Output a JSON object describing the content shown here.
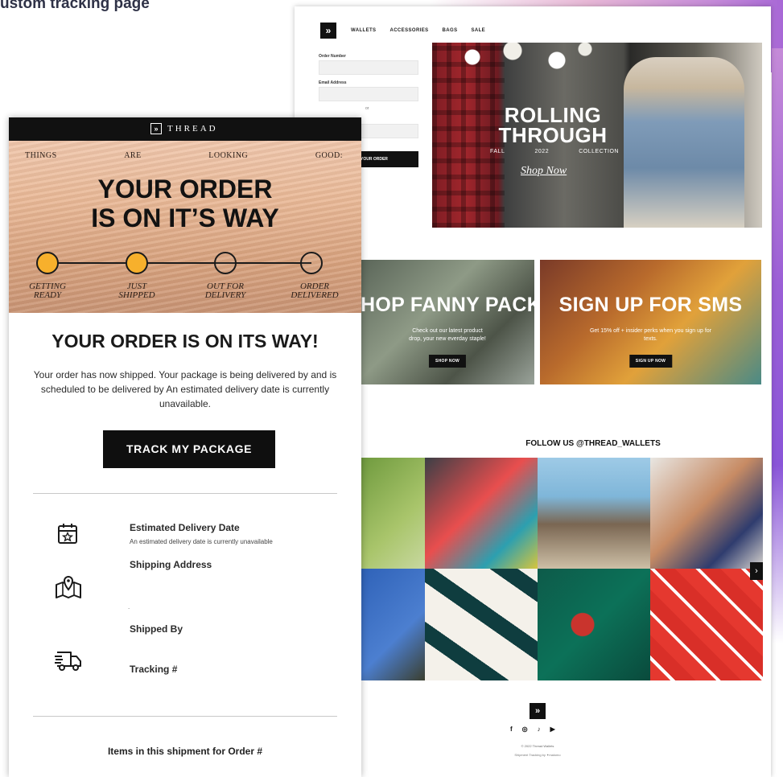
{
  "caption": "ustom tracking page",
  "store": {
    "logo": "»",
    "nav": [
      "WALLETS",
      "ACCESSORIES",
      "BAGS",
      "SALE"
    ],
    "form": {
      "order_label": "Order Number",
      "email_label": "Email Address",
      "or": "or",
      "button": "YOUR ORDER"
    },
    "hero": {
      "title_line1": "ROLLING",
      "title_line2": "THROUGH",
      "sub": [
        "FALL",
        "2022",
        "COLLECTION"
      ],
      "link": "Shop Now"
    },
    "promo_left": {
      "title": "HOP FANNY PACKS",
      "text": "Check out our latest product drop, your new everday staple!",
      "button": "SHOP NOW"
    },
    "promo_right": {
      "title": "SIGN UP FOR SMS",
      "text": "Get 15% off + insider perks when you sign up for texts.",
      "button": "SIGN UP NOW"
    },
    "follow": "FOLLOW US @THREAD_WALLETS",
    "gallery_next": "›",
    "footer": {
      "logo": "»",
      "socials": [
        "f",
        "◎",
        "♪",
        "▶"
      ],
      "copyright": "© 2022 Thread Wallets",
      "powered": "Shipment Tracking by ✦malomo"
    }
  },
  "email": {
    "logo_mark": "»",
    "brand": "THREAD",
    "hero_words": [
      "THINGS",
      "ARE",
      "LOOKING",
      "GOOD:"
    ],
    "hero_title_line1": "YOUR ORDER",
    "hero_title_line2": "IS ON IT’S WAY",
    "steps": [
      {
        "line1": "GETTING",
        "line2": "READY",
        "done": true
      },
      {
        "line1": "JUST",
        "line2": "SHIPPED",
        "done": true
      },
      {
        "line1": "OUT FOR",
        "line2": "DELIVERY",
        "done": false
      },
      {
        "line1": "ORDER",
        "line2": "DELIVERED",
        "done": false
      }
    ],
    "step_color_done": "#f7b02c",
    "heading": "YOUR ORDER IS ON ITS WAY!",
    "body": "Your order has now shipped. Your package is being delivered by and is scheduled to be delivered by An estimated delivery date is currently unavailable.",
    "button": "TRACK MY PACKAGE",
    "estimated_label": "Estimated Delivery Date",
    "estimated_sub": "An estimated delivery date is currently unavailable",
    "shipping_label": "Shipping Address",
    "dot": ".",
    "shipped_by_label": "Shipped By",
    "tracking_label": "Tracking #",
    "items_heading": "Items in this shipment for Order #",
    "icons": {
      "calendar": "calendar-icon",
      "map": "map-pin-icon",
      "truck": "delivery-truck-icon"
    }
  }
}
